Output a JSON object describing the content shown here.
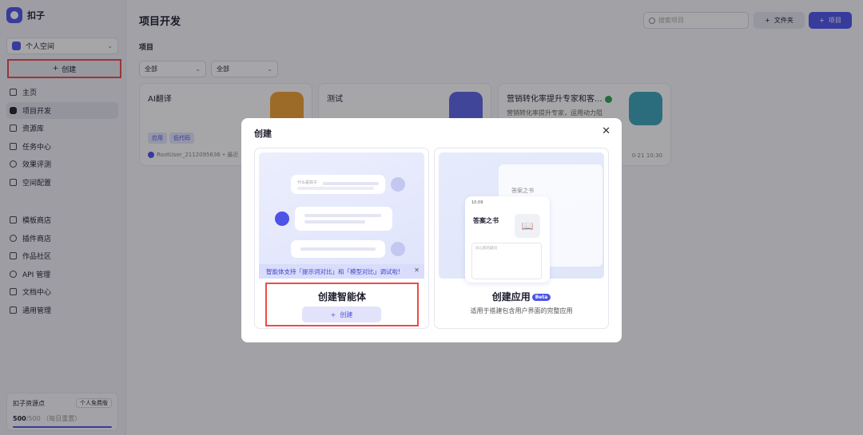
{
  "app": {
    "name": "扣子"
  },
  "sidebar": {
    "space": "个人空间",
    "create_label": "创建",
    "nav_main": [
      {
        "label": "主页",
        "icon": "home-icon"
      },
      {
        "label": "项目开发",
        "icon": "robot-icon"
      },
      {
        "label": "资源库",
        "icon": "library-icon"
      },
      {
        "label": "任务中心",
        "icon": "task-icon"
      },
      {
        "label": "效果评测",
        "icon": "gauge-icon"
      },
      {
        "label": "空间配置",
        "icon": "settings-icon"
      }
    ],
    "nav_secondary": [
      {
        "label": "模板商店",
        "icon": "template-icon"
      },
      {
        "label": "插件商店",
        "icon": "plugin-icon"
      },
      {
        "label": "作品社区",
        "icon": "community-icon"
      },
      {
        "label": "API 管理",
        "icon": "api-icon"
      },
      {
        "label": "文档中心",
        "icon": "doc-icon"
      },
      {
        "label": "通用管理",
        "icon": "manage-icon"
      }
    ],
    "resource": {
      "title": "扣子资源点",
      "badge": "个人免费版",
      "used": "500",
      "total": "/500",
      "note": "（每日重置）",
      "progress": 1.0
    }
  },
  "main": {
    "title": "项目开发",
    "search_placeholder": "搜索项目",
    "folder_label": "文件夹",
    "project_label": "项目",
    "section_label": "项目",
    "filters": [
      "全部",
      "全部"
    ],
    "projects": [
      {
        "name": "AI翻译",
        "desc": "",
        "tags": [
          "应用",
          "低代码"
        ],
        "meta": "RootUser_2112095636 • 最近",
        "thumb_color": "#f0a030"
      },
      {
        "name": "测试",
        "desc": "",
        "tags": [],
        "meta": "",
        "thumb_color": "#5c63e6"
      },
      {
        "name": "营销转化率提升专家和客...",
        "desc": "营销转化率提升专家，运用动力阻",
        "tags": [],
        "meta": "0-21 10:30",
        "thumb_color": "#3aa3b8"
      }
    ]
  },
  "modal": {
    "title": "创建",
    "close": "✕",
    "agent": {
      "bubble_hint": "什么是扣子",
      "notice": "智能体支持「提示词对比」和「模型对比」调试啦!",
      "notice_close": "✕",
      "title": "创建智能体",
      "create_label": "创建"
    },
    "app": {
      "window_title": "答案之书",
      "phone_time": "10:09",
      "phone_title": "答案之书",
      "phone_input": "问心底的疑问",
      "title": "创建应用",
      "beta": "Beta",
      "subtitle": "适用于搭建包含用户界面的完整应用"
    }
  }
}
